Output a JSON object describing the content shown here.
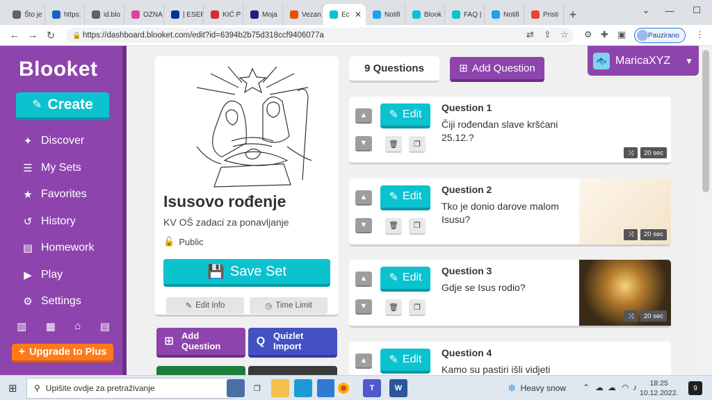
{
  "browser": {
    "tabs": [
      {
        "label": "Što je",
        "color": "#5f6368"
      },
      {
        "label": "https:",
        "color": "#1565c0"
      },
      {
        "label": "id.blo",
        "color": "#5f6368"
      },
      {
        "label": "OZNA",
        "color": "#e040a0"
      },
      {
        "label": "| ESEP",
        "color": "#003399"
      },
      {
        "label": "KIĆ P",
        "color": "#d32f2f"
      },
      {
        "label": "Moja",
        "color": "#1a237e"
      },
      {
        "label": "Vezan",
        "color": "#e65100"
      },
      {
        "label": "Ec",
        "color": "#0bc2cf",
        "active": true
      },
      {
        "label": "Notifi",
        "color": "#1da1f2"
      },
      {
        "label": "Blook",
        "color": "#0bc2cf"
      },
      {
        "label": "FAQ |",
        "color": "#0bc2cf"
      },
      {
        "label": "Notifi",
        "color": "#1da1f2"
      },
      {
        "label": "Pristi",
        "color": "#ea4335"
      }
    ],
    "new_tab_icon": "+",
    "url": "https://dashboard.blooket.com/edit?id=6394b2b75d318ccf9406077a",
    "profile_label": "Pauzirano"
  },
  "sidebar": {
    "logo": "Blooket",
    "create_label": "Create",
    "items": [
      {
        "label": "Discover",
        "icon": "compass-icon",
        "glyph": "✦"
      },
      {
        "label": "My Sets",
        "icon": "list-icon",
        "glyph": "☰"
      },
      {
        "label": "Favorites",
        "icon": "star-icon",
        "glyph": "★"
      },
      {
        "label": "History",
        "icon": "history-icon",
        "glyph": "↺"
      },
      {
        "label": "Homework",
        "icon": "document-icon",
        "glyph": "▤"
      },
      {
        "label": "Play",
        "icon": "play-icon",
        "glyph": "▶"
      },
      {
        "label": "Settings",
        "icon": "gear-icon",
        "glyph": "⚙"
      }
    ],
    "upgrade_label": "Upgrade to Plus"
  },
  "set": {
    "title": "Isusovo rođenje",
    "description": "KV OŠ zadaci za ponavljanje",
    "visibility": "Public",
    "save_label": "Save Set",
    "edit_info_label": "Edit Info",
    "time_limit_label": "Time Limit"
  },
  "actions": {
    "add_question_label": "Add Question",
    "quizlet_label": "Quizlet Import"
  },
  "questions_panel": {
    "count_label": "9 Questions",
    "add_label": "Add Question",
    "edit_label": "Edit",
    "items": [
      {
        "number": "Question 1",
        "text": "Čiji rođendan slave kršćani 25.12.?",
        "time": "20 sec"
      },
      {
        "number": "Question 2",
        "text": "Tko je donio darove malom Isusu?",
        "time": "20 sec"
      },
      {
        "number": "Question 3",
        "text": "Gdje se Isus rodio?",
        "time": "20 sec"
      },
      {
        "number": "Question 4",
        "text": "Kamo su pastiri išli vidjeti novorođenog Isusa?",
        "time": ""
      }
    ]
  },
  "user": {
    "name": "MaricaXYZ"
  },
  "taskbar": {
    "search_placeholder": "Upišite ovdje za pretraživanje",
    "weather": "Heavy snow",
    "time": "18:25",
    "date": "10.12.2022.",
    "notifications": "9"
  }
}
